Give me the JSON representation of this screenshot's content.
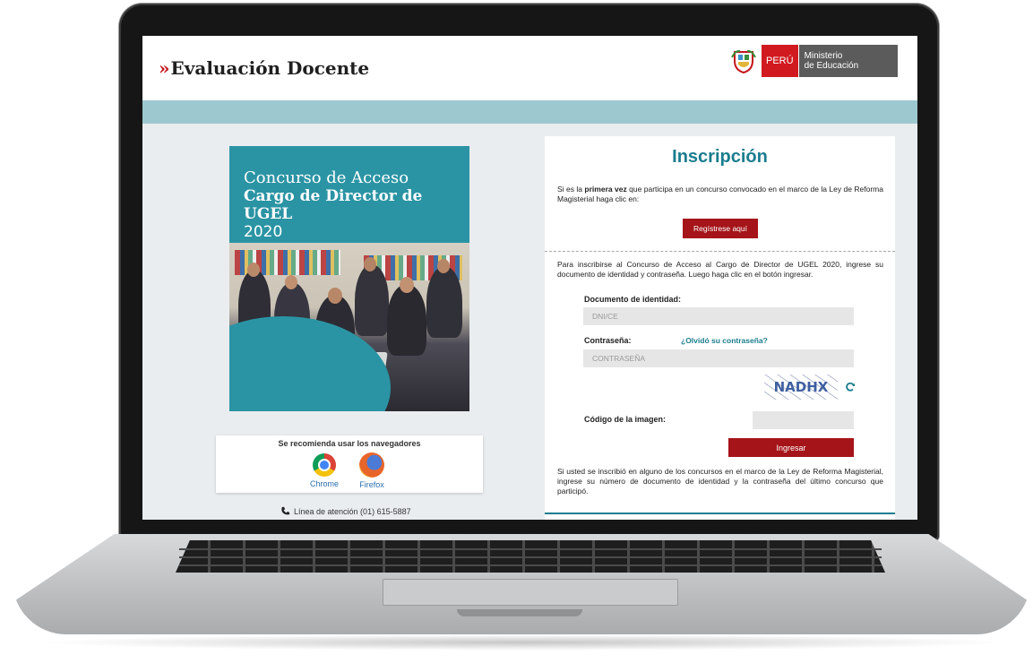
{
  "header": {
    "brand": "Evaluación Docente",
    "brand_mark": "»",
    "country": "PERÚ",
    "ministry_line1": "Ministerio",
    "ministry_line2": "de Educación"
  },
  "poster": {
    "line1": "Concurso de Acceso",
    "line2": "Cargo de Director de UGEL",
    "line3": "2020"
  },
  "browsers": {
    "title": "Se recomienda usar los navegadores",
    "items": [
      {
        "label": "Chrome",
        "icon": "chrome-icon"
      },
      {
        "label": "Firefox",
        "icon": "firefox-icon"
      }
    ]
  },
  "helpline": {
    "icon": "phone-icon",
    "text": "Línea de atención (01) 615-5887"
  },
  "registration": {
    "title": "Inscripción",
    "intro_pre": "Si es la ",
    "intro_bold": "primera vez",
    "intro_post": " que participa en un concurso convocado en el marco de la Ley de Reforma Magisterial haga clic en:",
    "register_button": "Regístrese aquí",
    "login_intro": "Para inscribirse al Concurso de Acceso al Cargo de Director de UGEL 2020, ingrese su documento de identidad y contraseña. Luego haga clic en el botón ingresar.",
    "doc_label": "Documento de identidad:",
    "doc_placeholder": "DNI/CE",
    "password_label": "Contraseña:",
    "forgot_link": "¿Olvidó su contraseña?",
    "password_placeholder": "CONTRASEÑA",
    "captcha_text": "NADHX",
    "captcha_label": "Código de la imagen:",
    "login_button": "Ingresar",
    "footer_note": "Si usted se inscribió en alguno de los concursos en el marco de la Ley de Reforma Magisterial, ingrese su número de documento de identidad y la contraseña del último concurso que participó."
  },
  "colors": {
    "accent_red": "#a51419",
    "teal_title": "#1a7d8e",
    "band": "#9ec8d0",
    "poster_bg": "#2b94a4"
  }
}
